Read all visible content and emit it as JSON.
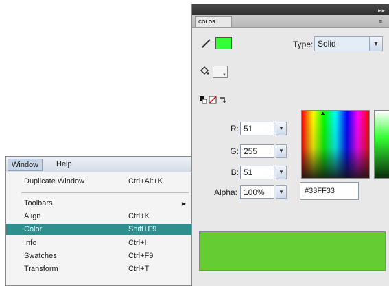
{
  "color_panel": {
    "tab_label": "COLOR",
    "type_label": "Type:",
    "type_value": "Solid",
    "stroke_color": "#33ff33",
    "fill_color": "#ffffff",
    "r_label": "R:",
    "r_value": "51",
    "g_label": "G:",
    "g_value": "255",
    "b_label": "B:",
    "b_value": "51",
    "alpha_label": "Alpha:",
    "alpha_value": "100%",
    "hex_value": "#33FF33",
    "preview_color": "#66cc33"
  },
  "menubar": {
    "window": "Window",
    "help": "Help"
  },
  "window_menu": {
    "items": [
      {
        "label": "Duplicate Window",
        "shortcut": "Ctrl+Alt+K"
      },
      {
        "label": "Toolbars",
        "shortcut": ""
      },
      {
        "label": "Align",
        "shortcut": "Ctrl+K"
      },
      {
        "label": "Color",
        "shortcut": "Shift+F9"
      },
      {
        "label": "Info",
        "shortcut": "Ctrl+I"
      },
      {
        "label": "Swatches",
        "shortcut": "Ctrl+F9"
      },
      {
        "label": "Transform",
        "shortcut": "Ctrl+T"
      }
    ]
  }
}
